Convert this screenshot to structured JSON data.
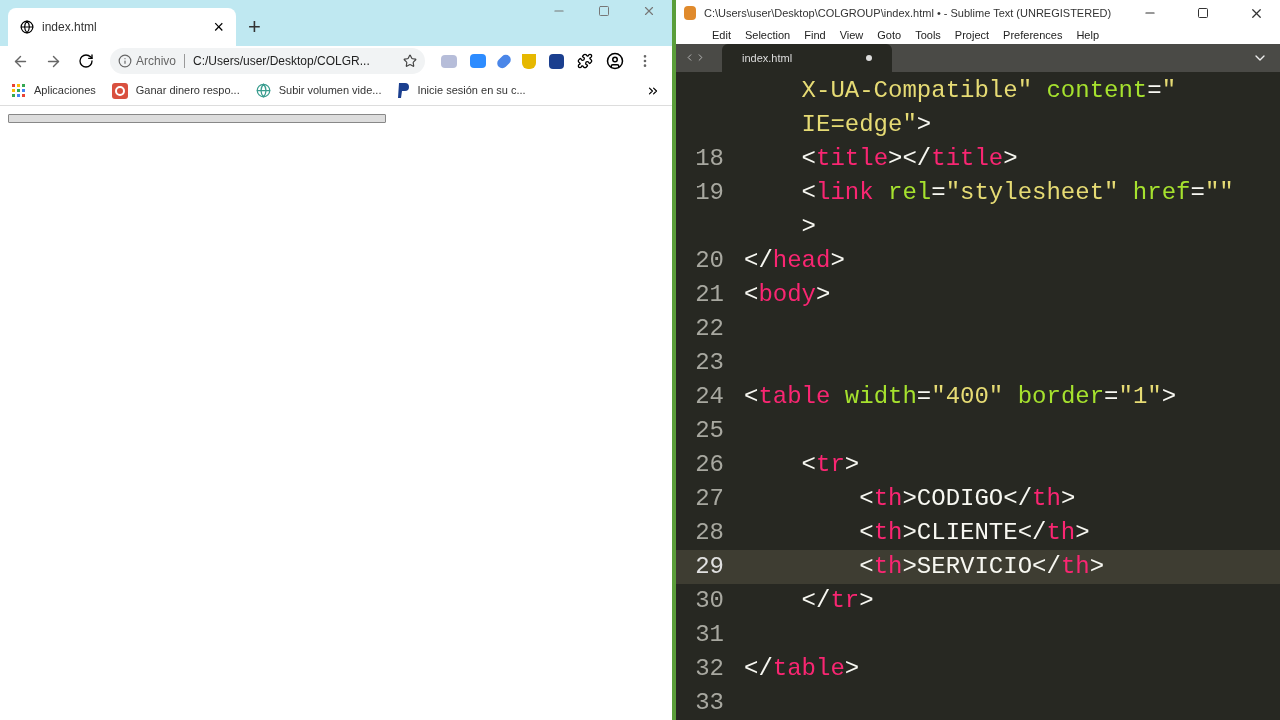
{
  "browser": {
    "tab": {
      "title": "index.html",
      "close": "×"
    },
    "new_tab": "+",
    "address": {
      "scheme": "Archivo",
      "url": "C:/Users/user/Desktop/COLGR..."
    },
    "bookmarks": [
      {
        "label": "Aplicaciones",
        "kind": "apps"
      },
      {
        "label": "Ganar dinero respo...",
        "kind": "red"
      },
      {
        "label": "Subir volumen vide...",
        "kind": "globe"
      },
      {
        "label": "Inicie sesión en su c...",
        "kind": "paypal"
      }
    ],
    "page": {
      "kind": "empty-table"
    }
  },
  "editor": {
    "title": "C:\\Users\\user\\Desktop\\COLGROUP\\index.html • - Sublime Text (UNREGISTERED)",
    "menu": [
      "Edit",
      "Selection",
      "Find",
      "View",
      "Goto",
      "Tools",
      "Project",
      "Preferences",
      "Help"
    ],
    "tab": {
      "title": "index.html",
      "modified": true
    },
    "lines": [
      {
        "selected": false,
        "tokens": [
          {
            "kind": "string",
            "text": "    X-UA-Compatible\""
          },
          {
            "kind": "attr",
            "text": " content"
          },
          {
            "kind": "plain",
            "text": "="
          },
          {
            "kind": "string",
            "text": "\""
          }
        ]
      },
      {
        "selected": false,
        "tokens": [
          {
            "kind": "string",
            "text": "    IE=edge\""
          },
          {
            "kind": "plain",
            "text": ">"
          }
        ]
      },
      {
        "number": "18",
        "selected": false,
        "tokens": [
          {
            "kind": "plain",
            "text": "    <"
          },
          {
            "kind": "tag",
            "text": "title"
          },
          {
            "kind": "plain",
            "text": "></"
          },
          {
            "kind": "tag",
            "text": "title"
          },
          {
            "kind": "plain",
            "text": ">"
          }
        ]
      },
      {
        "number": "19",
        "selected": false,
        "tokens": [
          {
            "kind": "plain",
            "text": "    <"
          },
          {
            "kind": "tag",
            "text": "link"
          },
          {
            "kind": "attr",
            "text": " rel"
          },
          {
            "kind": "plain",
            "text": "="
          },
          {
            "kind": "string",
            "text": "\"stylesheet\""
          },
          {
            "kind": "attr",
            "text": " href"
          },
          {
            "kind": "plain",
            "text": "="
          },
          {
            "kind": "string",
            "text": "\"\""
          }
        ]
      },
      {
        "selected": false,
        "tokens": [
          {
            "kind": "plain",
            "text": "    >"
          }
        ]
      },
      {
        "number": "20",
        "selected": false,
        "tokens": [
          {
            "kind": "plain",
            "text": "</"
          },
          {
            "kind": "tag",
            "text": "head"
          },
          {
            "kind": "plain",
            "text": ">"
          }
        ]
      },
      {
        "number": "21",
        "selected": false,
        "tokens": [
          {
            "kind": "plain",
            "text": "<"
          },
          {
            "kind": "tag",
            "text": "body"
          },
          {
            "kind": "plain",
            "text": ">"
          }
        ]
      },
      {
        "number": "22",
        "selected": false
      },
      {
        "number": "23",
        "selected": false
      },
      {
        "number": "24",
        "selected": false,
        "tokens": [
          {
            "kind": "plain",
            "text": "<"
          },
          {
            "kind": "tag",
            "text": "table"
          },
          {
            "kind": "attr",
            "text": " width"
          },
          {
            "kind": "plain",
            "text": "="
          },
          {
            "kind": "string",
            "text": "\"400\""
          },
          {
            "kind": "attr",
            "text": " border"
          },
          {
            "kind": "plain",
            "text": "="
          },
          {
            "kind": "string",
            "text": "\"1\""
          },
          {
            "kind": "plain",
            "text": ">"
          }
        ]
      },
      {
        "number": "25",
        "selected": false
      },
      {
        "number": "26",
        "selected": false,
        "tokens": [
          {
            "kind": "plain",
            "text": "    <"
          },
          {
            "kind": "tag",
            "text": "tr"
          },
          {
            "kind": "plain",
            "text": ">"
          }
        ]
      },
      {
        "number": "27",
        "selected": false,
        "tokens": [
          {
            "kind": "plain",
            "text": "        <"
          },
          {
            "kind": "tag",
            "text": "th"
          },
          {
            "kind": "plain",
            "text": ">CODIGO</"
          },
          {
            "kind": "tag",
            "text": "th"
          },
          {
            "kind": "plain",
            "text": ">"
          }
        ]
      },
      {
        "number": "28",
        "selected": false,
        "tokens": [
          {
            "kind": "plain",
            "text": "        <"
          },
          {
            "kind": "tag",
            "text": "th"
          },
          {
            "kind": "plain",
            "text": ">CLIENTE</"
          },
          {
            "kind": "tag",
            "text": "th"
          },
          {
            "kind": "plain",
            "text": ">"
          }
        ]
      },
      {
        "number": "29",
        "selected": true,
        "tokens": [
          {
            "kind": "plain",
            "text": "        <"
          },
          {
            "kind": "tag",
            "text": "th"
          },
          {
            "kind": "plain",
            "text": ">SERVICIO</"
          },
          {
            "kind": "tag",
            "text": "th"
          },
          {
            "kind": "plain",
            "text": ">"
          }
        ]
      },
      {
        "number": "30",
        "selected": false,
        "tokens": [
          {
            "kind": "plain",
            "text": "    </"
          },
          {
            "kind": "tag",
            "text": "tr"
          },
          {
            "kind": "plain",
            "text": ">"
          }
        ]
      },
      {
        "number": "31",
        "selected": false
      },
      {
        "number": "32",
        "selected": false,
        "tokens": [
          {
            "kind": "plain",
            "text": "</"
          },
          {
            "kind": "tag",
            "text": "table"
          },
          {
            "kind": "plain",
            "text": ">"
          }
        ]
      },
      {
        "number": "33",
        "selected": false
      }
    ]
  }
}
